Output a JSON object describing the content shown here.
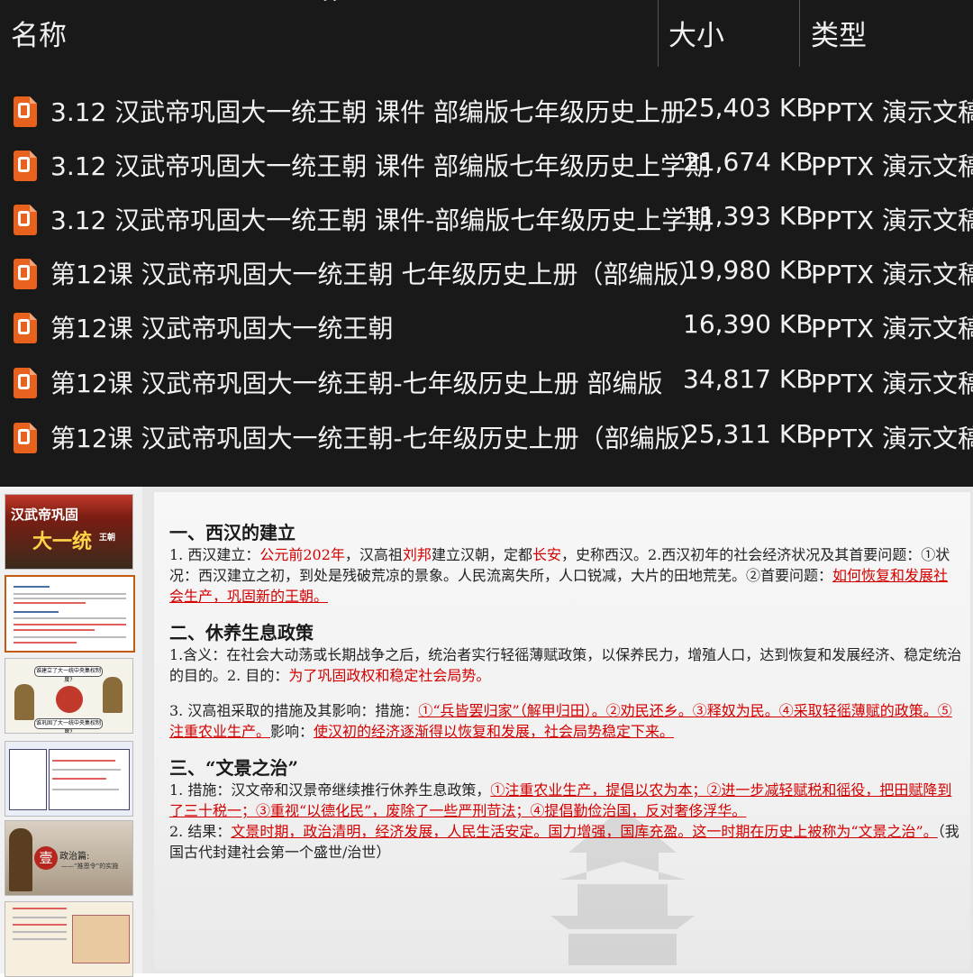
{
  "explorer": {
    "columns": {
      "name": "名称",
      "size": "大小",
      "type": "类型"
    },
    "sort_indicator": "^",
    "files": [
      {
        "icon": "pptx-file-icon",
        "name": "3.12 汉武帝巩固大一统王朝 课件 部编版七年级历史上册",
        "size": "25,403 KB",
        "type": "PPTX 演示文稿"
      },
      {
        "icon": "pptx-file-icon",
        "name": "3.12 汉武帝巩固大一统王朝 课件 部编版七年级历史上学期",
        "size": "21,674 KB",
        "type": "PPTX 演示文稿"
      },
      {
        "icon": "pptx-file-icon",
        "name": "3.12 汉武帝巩固大一统王朝 课件-部编版七年级历史上学期",
        "size": "11,393 KB",
        "type": "PPTX 演示文稿"
      },
      {
        "icon": "pptx-file-icon",
        "name": "第12课 汉武帝巩固大一统王朝 七年级历史上册（部编版）",
        "size": "19,980 KB",
        "type": "PPTX 演示文稿"
      },
      {
        "icon": "pptx-file-icon",
        "name": "第12课 汉武帝巩固大一统王朝",
        "size": "16,390 KB",
        "type": "PPTX 演示文稿"
      },
      {
        "icon": "pptx-file-icon",
        "name": "第12课 汉武帝巩固大一统王朝-七年级历史上册 部编版",
        "size": "34,817 KB",
        "type": "PPTX 演示文稿"
      },
      {
        "icon": "pptx-file-icon",
        "name": "第12课 汉武帝巩固大一统王朝-七年级历史上册（部编版）",
        "size": "25,311 KB",
        "type": "PPTX 演示文稿"
      }
    ]
  },
  "thumbnails": {
    "t1": {
      "title_a": "汉武帝巩固",
      "title_b": "大一统",
      "title_c": "王朝"
    },
    "t3": {
      "q1": "谁建立了大一统中央集权制度?",
      "q2": "谁巩固了大一统中央集权制度?"
    },
    "t5": {
      "badge": "壹",
      "caption": "政治篇:",
      "sub": "——“推恩令”的实施"
    }
  },
  "slide": {
    "s1_title": "一、西汉的建立",
    "s1_p1_a": "1. 西汉建立：",
    "s1_p1_b": "公元前202年",
    "s1_p1_c": "，汉高祖",
    "s1_p1_d": "刘邦",
    "s1_p1_e": "建立汉朝，定都",
    "s1_p1_f": "长安",
    "s1_p1_g": "，史称西汉。2.西汉初年的社会经济状况及其首要问题：①状况：西汉建立之初，到处是残破荒凉的景象。人民流离失所，人口锐减，大片的田地荒芜。②首要问题：",
    "s1_p1_h": "如何恢复和发展社会生产，巩固新的王朝。",
    "s2_title": "二、休养生息政策",
    "s2_p1_a": "1.含义：在社会大动荡或长期战争之后，统治者实行轻徭薄赋政策，以保养民力，增殖人口，达到恢复和发展经济、稳定统治的目的。2. 目的：",
    "s2_p1_b": "为了巩固政权和稳定社会局势。",
    "s2_p2_a": "3. 汉高祖采取的措施及其影响：措施：",
    "s2_p2_b": "①“兵皆罢归家”（解甲归田）。②劝民还乡。③释奴为民。④采取轻徭薄赋的政策。⑤注重农业生产。",
    "s2_p2_c": "影响：",
    "s2_p2_d": "使汉初的经济逐渐得以恢复和发展，社会局势稳定下来。",
    "s3_title": "三、“文景之治”",
    "s3_p1_a": "1. 措施：汉文帝和汉景帝继续推行休养生息政策，",
    "s3_p1_b": "①注重农业生产，提倡以农为本；②进一步减轻赋税和徭役，把田赋降到了三十税一；③重视“以德化民”，废除了一些严刑苛法；④提倡勤俭治国，反对奢侈浮华。",
    "s3_p2_a": "2. 结果：",
    "s3_p2_b": "文景时期，政治清明，经济发展，人民生活安定。国力增强，国库充盈。这一时期在历史上被称为“文景之治”。",
    "s3_p2_c": "（我国古代封建社会第一个盛世/治世）"
  }
}
